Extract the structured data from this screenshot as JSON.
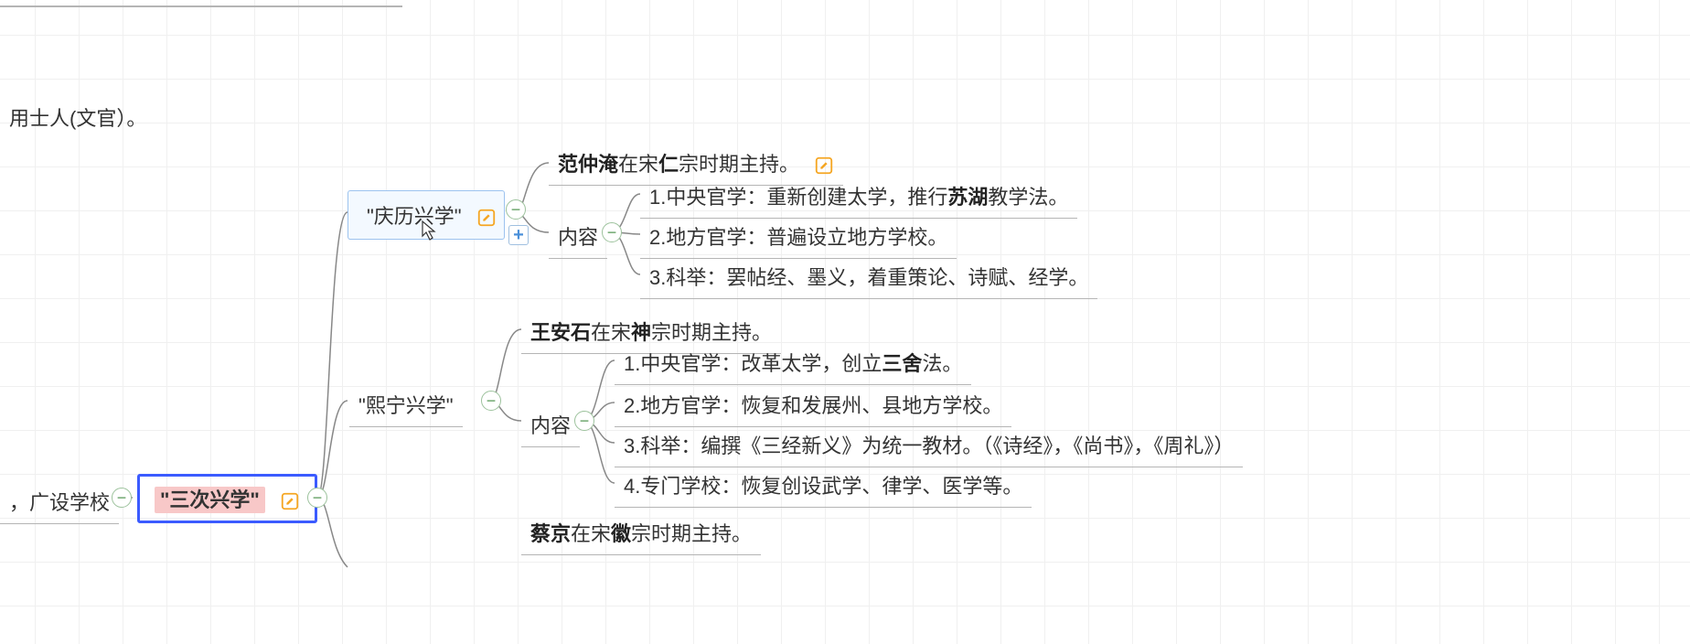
{
  "fragments": {
    "top_left": "用士人(文官）。",
    "left_mid": "，广设学校"
  },
  "root": {
    "label": "\"三次兴学\""
  },
  "branch1": {
    "label": "\"庆历兴学\"",
    "head_b1": "范仲淹",
    "head_plain1": "在宋",
    "head_b2": "仁",
    "head_plain2": "宗时期主持。",
    "content_label": "内容",
    "items": {
      "i1_pre": "1.中央官学：重新创建太学，推行",
      "i1_b": "苏湖",
      "i1_post": "教学法。",
      "i2": "2.地方官学：普遍设立地方学校。",
      "i3": "3.科举：罢帖经、墨义，着重策论、诗赋、经学。"
    }
  },
  "branch2": {
    "label": "\"熙宁兴学\"",
    "head_b1": "王安石",
    "head_plain1": "在宋",
    "head_b2": "神",
    "head_plain2": "宗时期主持。",
    "content_label": "内容",
    "items": {
      "i1_pre": "1.中央官学：改革太学，创立",
      "i1_b": "三舍",
      "i1_post": "法。",
      "i2": "2.地方官学：恢复和发展州、县地方学校。",
      "i3": "3.科举：编撰《三经新义》为统一教材。（《诗经》，《尚书》，《周礼》）",
      "i4": "4.专门学校：恢复创设武学、律学、医学等。"
    }
  },
  "branch3": {
    "head_b1": "蔡京",
    "head_plain1": "在宋",
    "head_b2": "徽",
    "head_plain2": "宗时期主持。"
  },
  "toggles": {
    "minus": "−",
    "plus": "+"
  }
}
